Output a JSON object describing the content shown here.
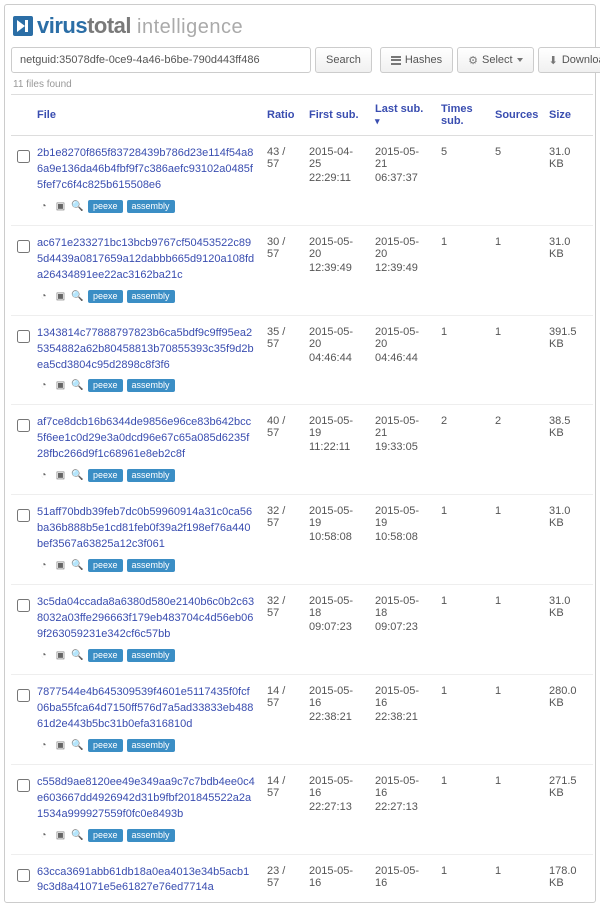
{
  "brand": {
    "virus": "virus",
    "total": "total",
    "intelligence": "intelligence"
  },
  "search": {
    "value": "netguid:35078dfe-0ce9-4a46-b6be-790d443ff486",
    "button": "Search"
  },
  "toolbar": {
    "hashes": "Hashes",
    "select": "Select",
    "download": "Download"
  },
  "found_label": "11 files found",
  "columns": {
    "file": "File",
    "ratio": "Ratio",
    "first_sub": "First sub.",
    "last_sub": "Last sub.",
    "times_sub": "Times sub.",
    "sources": "Sources",
    "size": "Size"
  },
  "tags": {
    "peexe": "peexe",
    "assembly": "assembly"
  },
  "rows": [
    {
      "hash": "2b1e8270f865f83728439b786d23e114f54a86a9e136da46b4fbf9f7c386aefc93102a0485f5fef7c6f4c825b615508e6",
      "ratio": "43 / 57",
      "first_date": "2015-04-25",
      "first_time": "22:29:11",
      "last_date": "2015-05-21",
      "last_time": "06:37:37",
      "times": "5",
      "sources": "5",
      "size": "31.0 KB"
    },
    {
      "hash": "ac671e233271bc13bcb9767cf50453522c895d4439a0817659a12dabbb665d9120a108fda26434891ee22ac3162ba21c",
      "ratio": "30 / 57",
      "first_date": "2015-05-20",
      "first_time": "12:39:49",
      "last_date": "2015-05-20",
      "last_time": "12:39:49",
      "times": "1",
      "sources": "1",
      "size": "31.0 KB"
    },
    {
      "hash": "1343814c77888797823b6ca5bdf9c9ff95ea25354882a62b80458813b70855393c35f9d2bea5cd3804c95d2898c8f3f6",
      "ratio": "35 / 57",
      "first_date": "2015-05-20",
      "first_time": "04:46:44",
      "last_date": "2015-05-20",
      "last_time": "04:46:44",
      "times": "1",
      "sources": "1",
      "size": "391.5 KB"
    },
    {
      "hash": "af7ce8dcb16b6344de9856e96ce83b642bcc5f6ee1c0d29e3a0dcd96e67c65a085d6235f28fbc266d9f1c68961e8eb2c8f",
      "ratio": "40 / 57",
      "first_date": "2015-05-19",
      "first_time": "11:22:11",
      "last_date": "2015-05-21",
      "last_time": "19:33:05",
      "times": "2",
      "sources": "2",
      "size": "38.5 KB"
    },
    {
      "hash": "51aff70bdb39feb7dc0b59960914a31c0ca56ba36b888b5e1cd81feb0f39a2f198ef76a440bef3567a63825a12c3f061",
      "ratio": "32 / 57",
      "first_date": "2015-05-19",
      "first_time": "10:58:08",
      "last_date": "2015-05-19",
      "last_time": "10:58:08",
      "times": "1",
      "sources": "1",
      "size": "31.0 KB"
    },
    {
      "hash": "3c5da04ccada8a6380d580e2140b6c0b2c638032a03ffe296663f179eb483704c4d56eb069f263059231e342cf6c57bb",
      "ratio": "32 / 57",
      "first_date": "2015-05-18",
      "first_time": "09:07:23",
      "last_date": "2015-05-18",
      "last_time": "09:07:23",
      "times": "1",
      "sources": "1",
      "size": "31.0 KB"
    },
    {
      "hash": "7877544e4b645309539f4601e5117435f0fcf06ba55fca64d7150ff576d7a5ad33833eb48861d2e443b5bc31b0efa316810d",
      "ratio": "14 / 57",
      "first_date": "2015-05-16",
      "first_time": "22:38:21",
      "last_date": "2015-05-16",
      "last_time": "22:38:21",
      "times": "1",
      "sources": "1",
      "size": "280.0 KB"
    },
    {
      "hash": "c558d9ae8120ee49e349aa9c7c7bdb4ee0c4e603667dd4926942d31b9fbf201845522a2a1534a999927559f0fc0e8493b",
      "ratio": "14 / 57",
      "first_date": "2015-05-16",
      "first_time": "22:27:13",
      "last_date": "2015-05-16",
      "last_time": "22:27:13",
      "times": "1",
      "sources": "1",
      "size": "271.5 KB"
    },
    {
      "hash": "63cca3691abb61db18a0ea4013e34b5acb19c3d8a41071e5e61827e76ed7714a",
      "ratio": "23 / 57",
      "first_date": "2015-05-16",
      "first_time": "",
      "last_date": "2015-05-16",
      "last_time": "",
      "times": "1",
      "sources": "1",
      "size": "178.0 KB"
    }
  ]
}
